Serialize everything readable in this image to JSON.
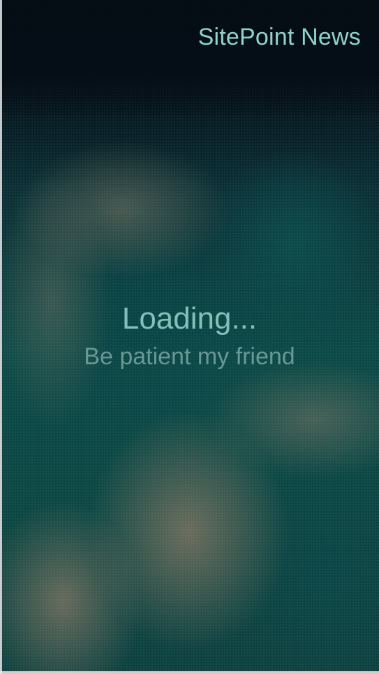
{
  "header": {
    "app_title": "SitePoint News"
  },
  "loading": {
    "title": "Loading...",
    "subtitle": "Be patient my friend"
  },
  "colors": {
    "accent_text": "#8fd3cc",
    "background_dark": "#06121b",
    "background_teal": "#0c4a48"
  }
}
